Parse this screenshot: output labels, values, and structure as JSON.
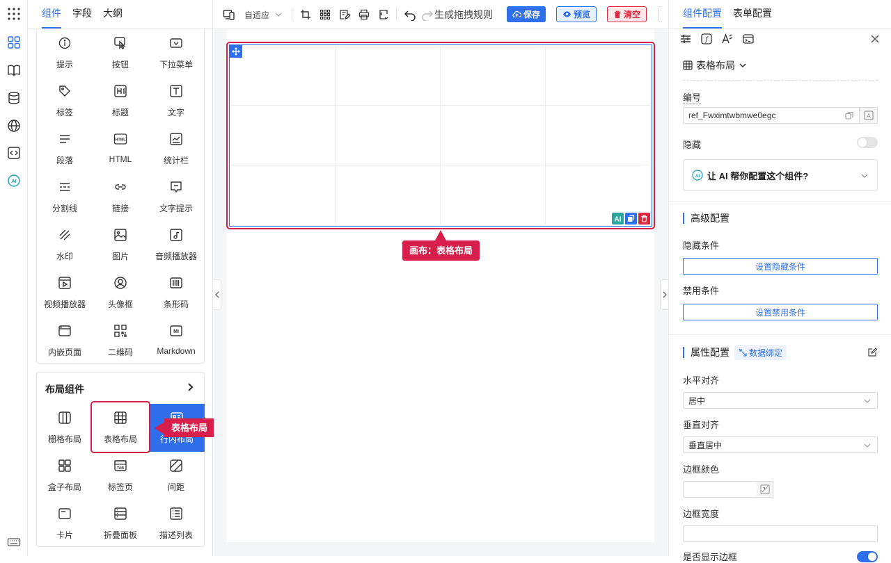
{
  "left_tabs": [
    "组件",
    "字段",
    "大纲"
  ],
  "basic_components": [
    {
      "label": "提示",
      "icon": "info-icon"
    },
    {
      "label": "按钮",
      "icon": "button-icon"
    },
    {
      "label": "下拉菜单",
      "icon": "dropdown-icon"
    },
    {
      "label": "标签",
      "icon": "tag-icon"
    },
    {
      "label": "标题",
      "icon": "heading-icon"
    },
    {
      "label": "文字",
      "icon": "text-icon"
    },
    {
      "label": "段落",
      "icon": "paragraph-icon"
    },
    {
      "label": "HTML",
      "icon": "html-icon"
    },
    {
      "label": "统计栏",
      "icon": "statistic-icon"
    },
    {
      "label": "分割线",
      "icon": "divider-icon"
    },
    {
      "label": "链接",
      "icon": "link-icon"
    },
    {
      "label": "文字提示",
      "icon": "tooltip-icon"
    },
    {
      "label": "水印",
      "icon": "watermark-icon"
    },
    {
      "label": "图片",
      "icon": "image-icon"
    },
    {
      "label": "音频播放器",
      "icon": "audio-icon"
    },
    {
      "label": "视频播放器",
      "icon": "video-icon"
    },
    {
      "label": "头像框",
      "icon": "avatar-icon"
    },
    {
      "label": "条形码",
      "icon": "barcode-icon"
    },
    {
      "label": "内嵌页面",
      "icon": "iframe-icon"
    },
    {
      "label": "二维码",
      "icon": "qrcode-icon"
    },
    {
      "label": "Markdown",
      "icon": "markdown-icon"
    }
  ],
  "layout_group": {
    "title": "布局组件",
    "items": [
      {
        "label": "栅格布局",
        "icon": "grid-layout-icon"
      },
      {
        "label": "表格布局",
        "icon": "table-layout-icon"
      },
      {
        "label": "行内布局",
        "icon": "inline-layout-icon"
      },
      {
        "label": "盒子布局",
        "icon": "box-layout-icon"
      },
      {
        "label": "标签页",
        "icon": "tabs-icon"
      },
      {
        "label": "间距",
        "icon": "spacing-icon"
      },
      {
        "label": "卡片",
        "icon": "card-icon"
      },
      {
        "label": "折叠面板",
        "icon": "collapse-icon"
      },
      {
        "label": "描述列表",
        "icon": "descriptions-icon"
      }
    ]
  },
  "callouts": {
    "left": "表格布局",
    "canvas": "画布：表格布局"
  },
  "toolbar": {
    "device_mode": "自适应",
    "generate_rule": "生成拖拽规则",
    "save": "保存",
    "preview": "预览",
    "clear": "清空"
  },
  "right_tabs": [
    "组件配置",
    "表单配置"
  ],
  "config": {
    "component_type": "表格布局",
    "id_label": "编号",
    "id_value": "ref_Fwximtwbmwe0egc",
    "hidden_label": "隐藏",
    "ai_prompt": "让 AI 帮你配置这个组件?",
    "advanced_title": "高级配置",
    "hide_cond_label": "隐藏条件",
    "hide_cond_btn": "设置隐藏条件",
    "disable_cond_label": "禁用条件",
    "disable_cond_btn": "设置禁用条件",
    "props_title": "属性配置",
    "binding_tag": "数据绑定",
    "h_align_label": "水平对齐",
    "h_align_value": "居中",
    "v_align_label": "垂直对齐",
    "v_align_value": "垂直居中",
    "border_color_label": "边框颜色",
    "border_width_label": "边框宽度",
    "show_border_label": "是否显示边框"
  },
  "colors": {
    "accent": "#2f6fec",
    "danger": "#e0263f",
    "highlight": "#d81e4a"
  }
}
